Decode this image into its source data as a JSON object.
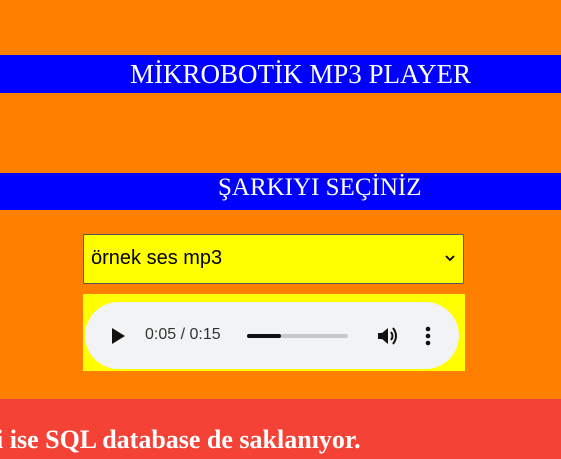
{
  "header": {
    "title": "MİKROBOTİK MP3 PLAYER",
    "subtitle": "ŞARKIYI SEÇİNİZ"
  },
  "song_select": {
    "selected": "örnek ses mp3"
  },
  "audio_player": {
    "time": "0:05 / 0:15",
    "progress_fraction": 0.333
  },
  "footer": {
    "text": "i ise SQL database de saklanıyor."
  },
  "colors": {
    "background": "#ff8000",
    "banner": "#0000ff",
    "select_bg": "#ffff00",
    "footer": "#f44336"
  },
  "icons": [
    "chevron-down-icon",
    "play-icon",
    "volume-icon",
    "more-options-icon"
  ]
}
